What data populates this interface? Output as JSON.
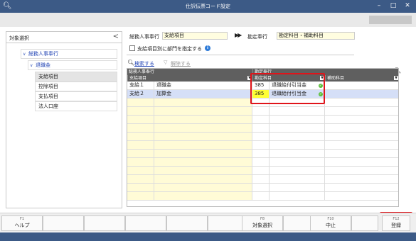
{
  "window": {
    "app_icon": "app-add-icon",
    "title": "仕訳伝票コード設定",
    "controls": [
      "minimize-icon",
      "maximize-icon",
      "close-icon"
    ]
  },
  "sidebar": {
    "title": "対象選択",
    "collapse_glyph": "<",
    "tree": [
      {
        "label": "総務人事奉行",
        "kind": "root",
        "expanded": true
      },
      {
        "label": "退職金",
        "kind": "node",
        "expanded": true
      },
      {
        "label": "支給項目",
        "kind": "leaf",
        "selected": true
      },
      {
        "label": "控除項目",
        "kind": "leaf",
        "selected": false
      },
      {
        "label": "支払項目",
        "kind": "leaf",
        "selected": false
      },
      {
        "label": "法人口座",
        "kind": "leaf",
        "selected": false
      }
    ]
  },
  "form": {
    "source_app_label": "総務人事奉行",
    "source_app_value": "支給項目",
    "target_app_label": "勘定奉行",
    "target_app_value": "勘定科目・補助科目",
    "dept_checkbox_label": "支給項目別に部門を指定する",
    "dept_checkbox_checked": false
  },
  "grid_toolbar": {
    "search_label": "検索する",
    "clear_label": "解除する"
  },
  "grid": {
    "group_left": "総務人事奉行",
    "group_right": "勘定奉行",
    "col_item": "支給項目",
    "col_account": "勘定科目",
    "col_sub": "補助科目",
    "rows": [
      {
        "code": "支給１",
        "name": "退職金",
        "acct_code": "385",
        "acct_name": "退職給付引当金",
        "status": "ok",
        "selected": false
      },
      {
        "code": "支給２",
        "name": "加算金",
        "acct_code": "385",
        "acct_name": "退職給付引当金",
        "status": "ok",
        "selected": true
      }
    ],
    "empty_rows": 12
  },
  "function_keys": [
    {
      "num": "F1",
      "label": "ヘルプ"
    },
    {
      "num": "",
      "label": ""
    },
    {
      "num": "",
      "label": ""
    },
    {
      "num": "",
      "label": ""
    },
    {
      "num": "",
      "label": ""
    },
    {
      "num": "F8",
      "label": "対象選択"
    },
    {
      "num": "",
      "label": ""
    },
    {
      "num": "F10",
      "label": "中止"
    },
    {
      "num": "",
      "label": ""
    },
    {
      "num": "F12",
      "label": "登録"
    }
  ],
  "colors": {
    "titlebar": "#3c5a86",
    "highlight": "#e0141a",
    "field_bg": "#fffde0",
    "selected_row": "#d5dff7",
    "edit_cell": "#ffff33",
    "ok_badge": "#5bbf3a"
  }
}
